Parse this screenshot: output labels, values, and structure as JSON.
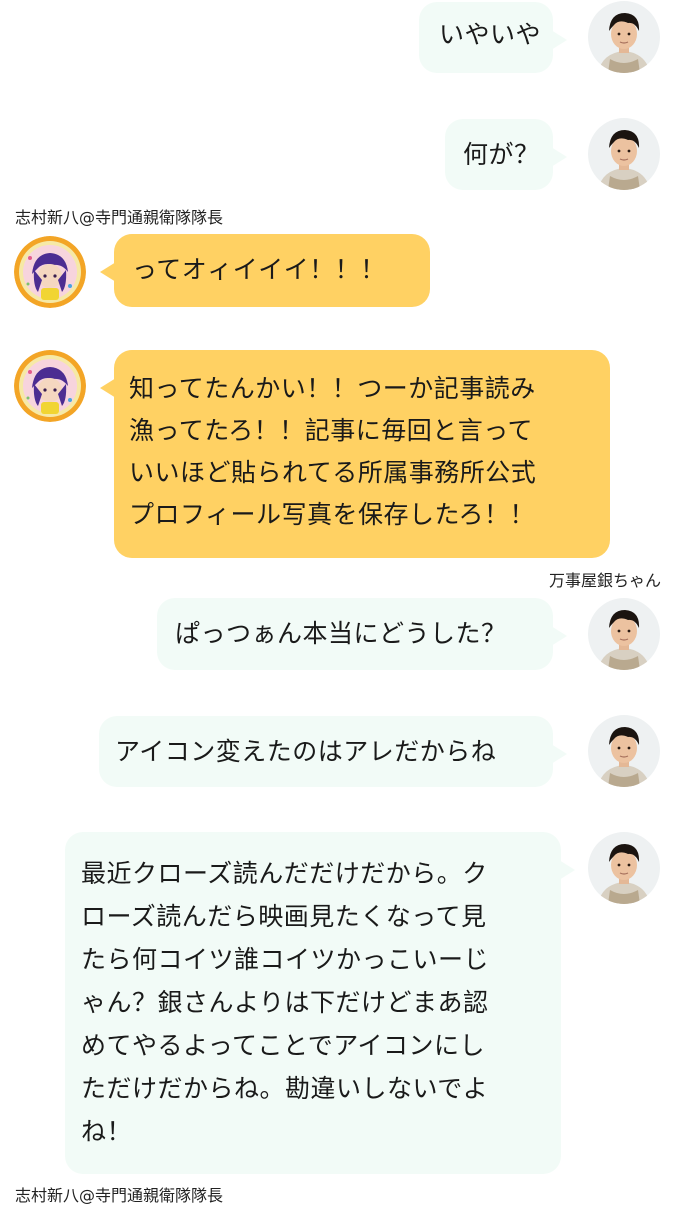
{
  "colors": {
    "my_bubble": "#f2fbf7",
    "their_bubble": "#ffd163",
    "background": "#ffffff"
  },
  "icons": {
    "my_avatar": "male-actor-portrait-avatar",
    "their_avatar": "anime-character-badge-avatar"
  },
  "messages": [
    {
      "side": "right",
      "text": [
        "いやいや"
      ]
    },
    {
      "side": "right",
      "text": [
        "何が？"
      ]
    },
    {
      "side": "left",
      "sender": "志村新八@寺門通親衛隊隊長",
      "text": [
        "ってオィイイイ！！！"
      ]
    },
    {
      "side": "left",
      "text": [
        "知ってたんかい！！つーか記事読み",
        "漁ってたろ！！記事に毎回と言って",
        "いいほど貼られてる所属事務所公式",
        "プロフィール写真を保存したろ！！"
      ]
    },
    {
      "side": "right",
      "sender": "万事屋銀ちゃん",
      "text": [
        "ぱっつぁん本当にどうした？"
      ]
    },
    {
      "side": "right",
      "text": [
        "アイコン変えたのはアレだからね"
      ]
    },
    {
      "side": "right",
      "text": [
        "最近クローズ読んだだけだから。ク",
        "ローズ読んだら映画見たくなって見",
        "たら何コイツ誰コイツかっこいーじ",
        "ゃん？銀さんよりは下だけどまあ認",
        "めてやるよってことでアイコンにし",
        "ただけだからね。勘違いしないでよ",
        "ね！"
      ]
    }
  ],
  "footer_sender": "志村新八@寺門通親衛隊隊長"
}
